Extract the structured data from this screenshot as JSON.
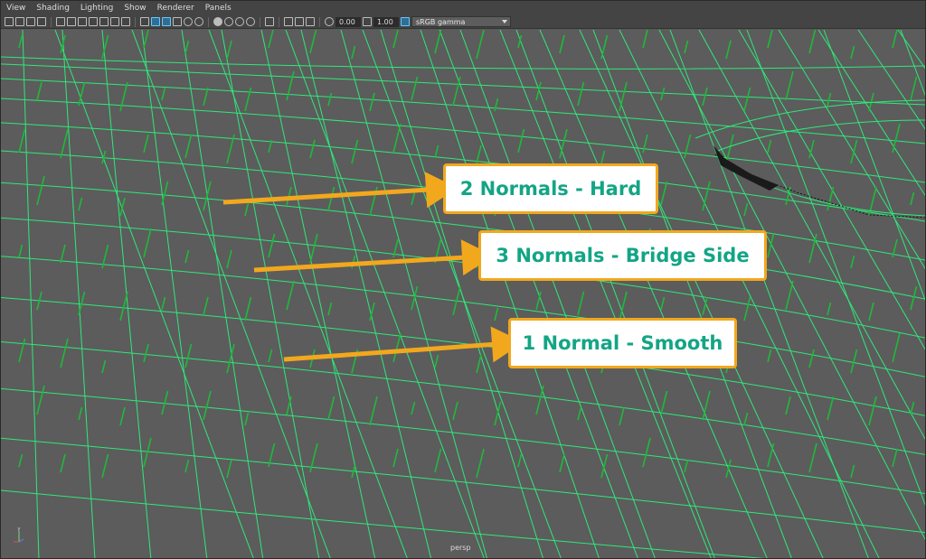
{
  "menu": [
    "View",
    "Shading",
    "Lighting",
    "Show",
    "Renderer",
    "Panels"
  ],
  "toolbar": {
    "exposure": "0.00",
    "gamma": "1.00",
    "color_space": "sRGB gamma"
  },
  "callouts": [
    {
      "label": "2 Normals - Hard"
    },
    {
      "label": "3 Normals - Bridge Side"
    },
    {
      "label": "1 Normal - Smooth"
    }
  ],
  "camera_label": "persp",
  "axis_label": "y",
  "colors": {
    "wireframe": "#2fe87a",
    "normals": "#1fb83a",
    "arrow": "#f2a81d",
    "callout_text": "#13a585",
    "viewport_bg": "#5c5c5c"
  }
}
